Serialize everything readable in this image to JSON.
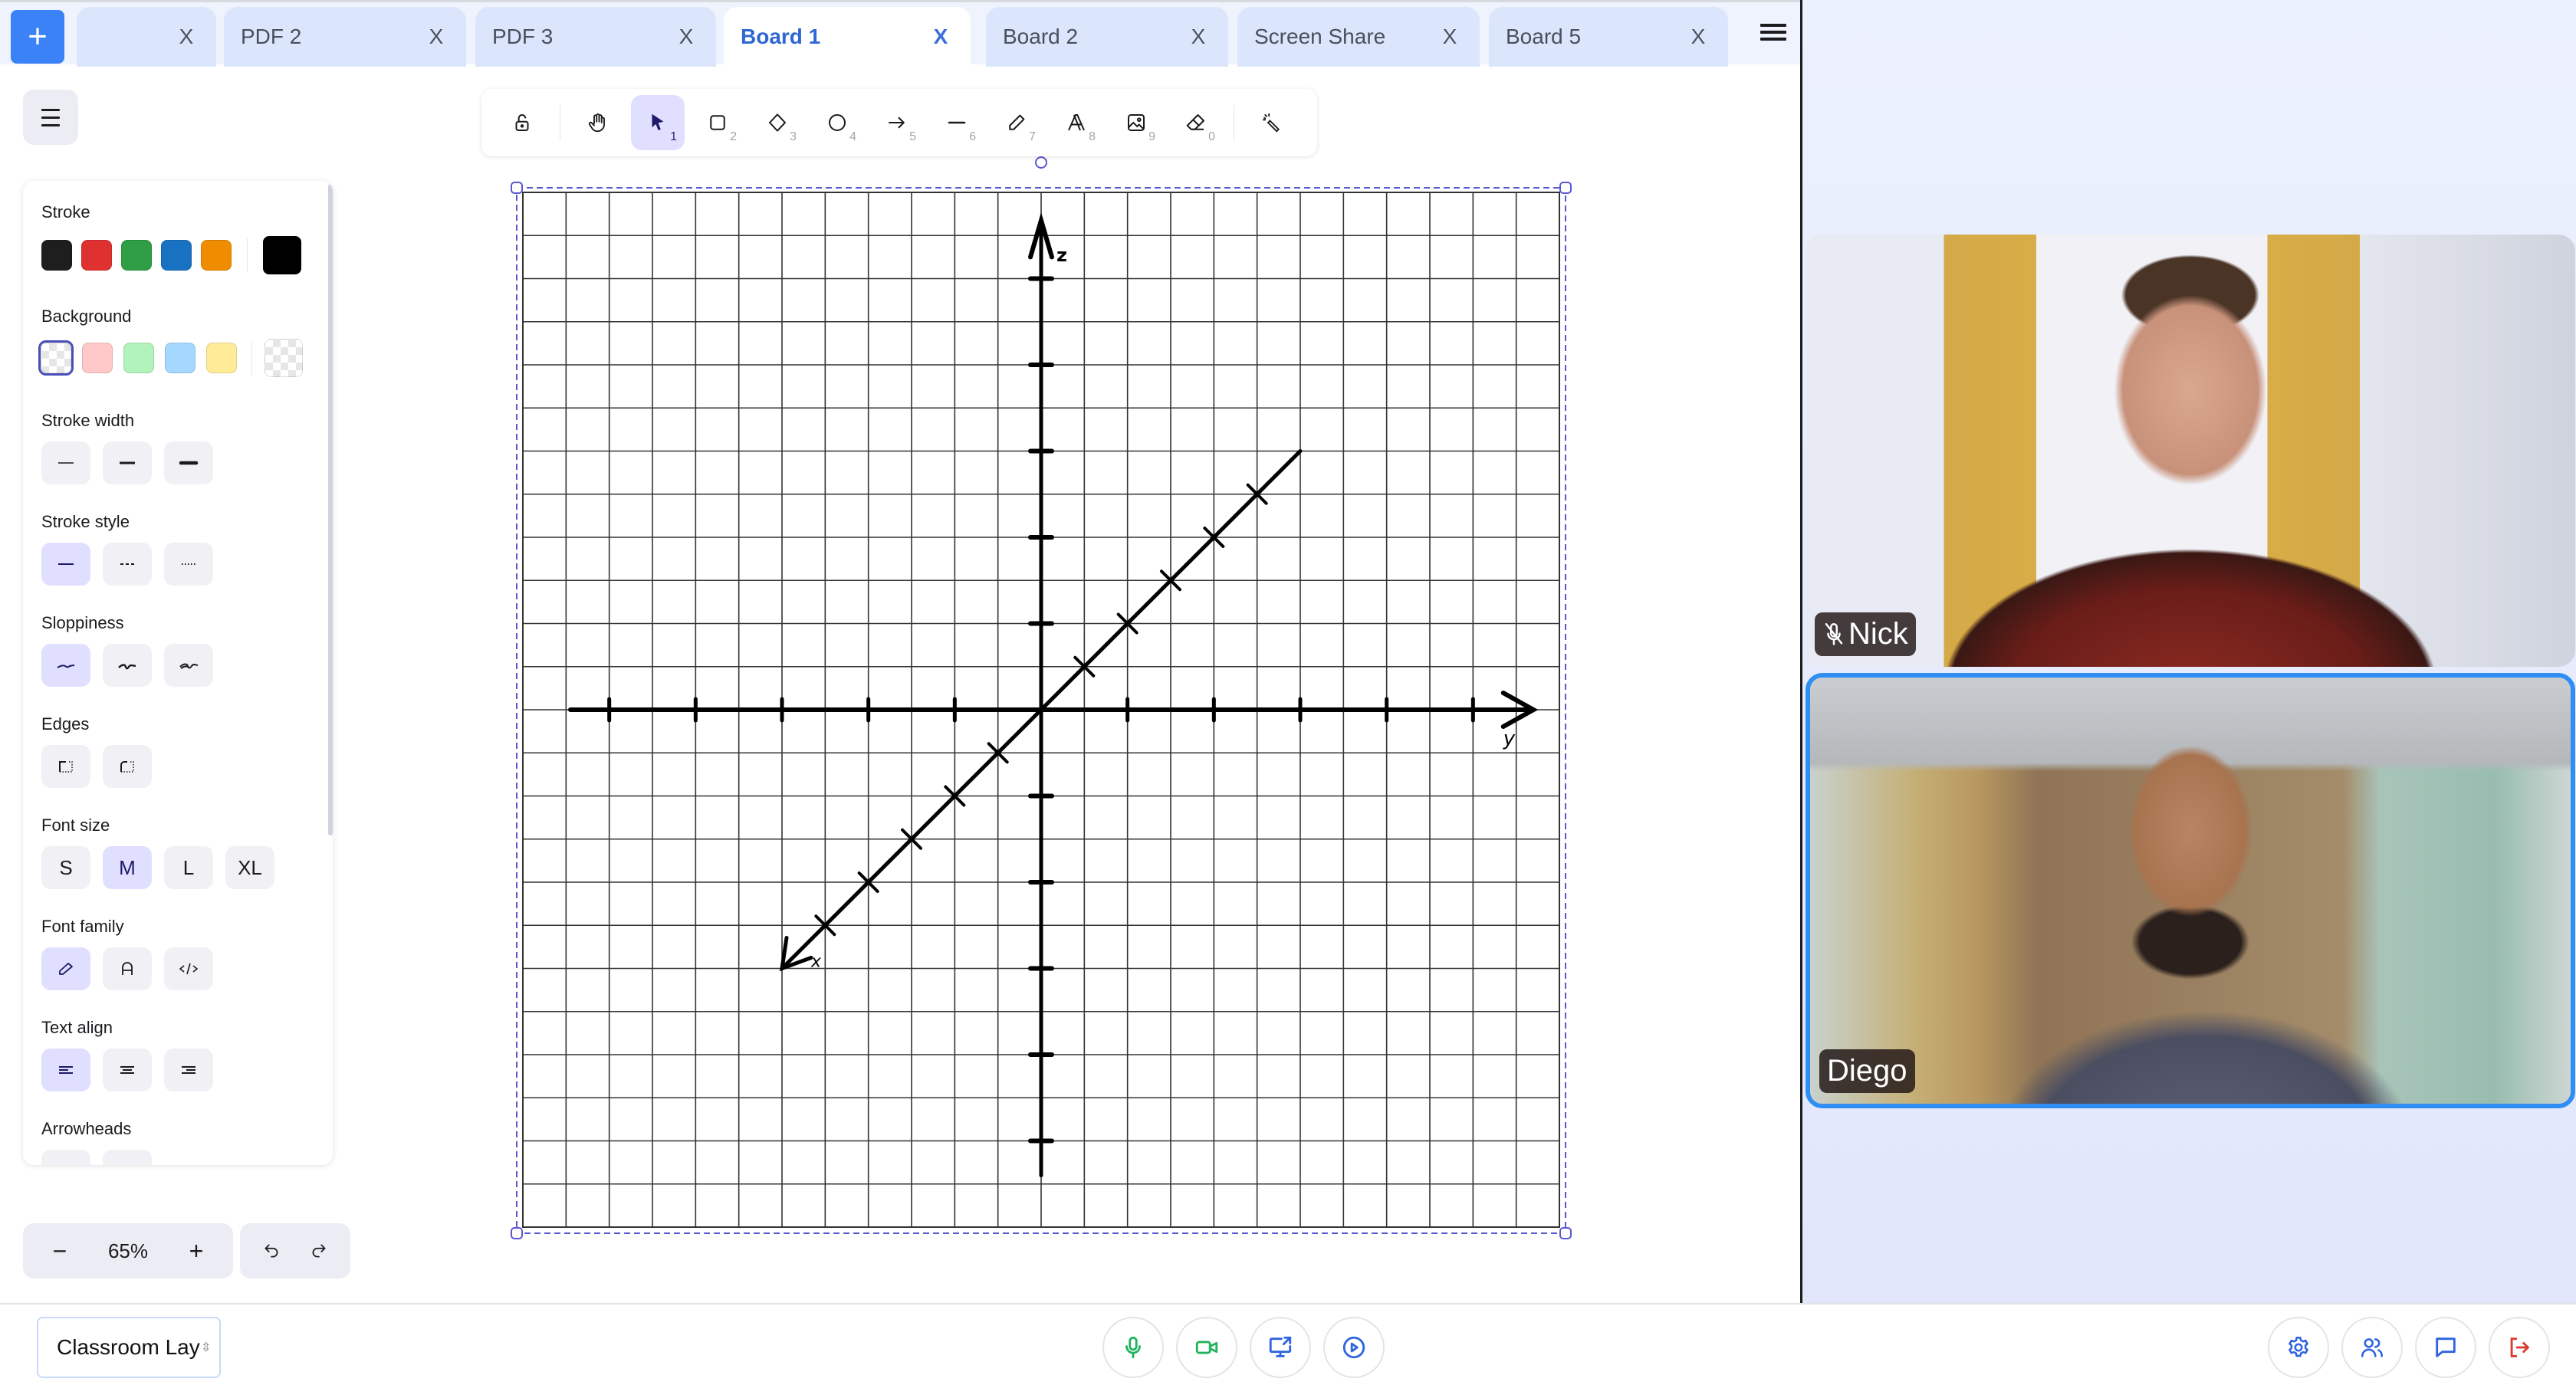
{
  "tabbar": {
    "add_label": "+",
    "tabs": [
      {
        "label": "",
        "close": "X",
        "active": false
      },
      {
        "label": "PDF 2",
        "close": "X",
        "active": false
      },
      {
        "label": "PDF 3",
        "close": "X",
        "active": false
      },
      {
        "label": "Board 1",
        "close": "X",
        "active": true
      },
      {
        "label": "Board 2",
        "close": "X",
        "active": false
      },
      {
        "label": "Screen Share",
        "close": "X",
        "active": false
      },
      {
        "label": "Board 5",
        "close": "X",
        "active": false
      }
    ]
  },
  "toolbar": {
    "tools": [
      {
        "name": "lock",
        "key": ""
      },
      {
        "name": "hand",
        "key": ""
      },
      {
        "name": "selection",
        "key": "1",
        "active": true
      },
      {
        "name": "rectangle",
        "key": "2"
      },
      {
        "name": "diamond",
        "key": "3"
      },
      {
        "name": "ellipse",
        "key": "4"
      },
      {
        "name": "arrow",
        "key": "5"
      },
      {
        "name": "line",
        "key": "6"
      },
      {
        "name": "draw",
        "key": "7"
      },
      {
        "name": "text",
        "key": "8"
      },
      {
        "name": "image",
        "key": "9"
      },
      {
        "name": "eraser",
        "key": "0"
      },
      {
        "name": "laser",
        "key": ""
      }
    ]
  },
  "properties": {
    "stroke_label": "Stroke",
    "stroke_colors": [
      "#1e1e1e",
      "#e03131",
      "#2f9e44",
      "#1971c2",
      "#f08c00"
    ],
    "stroke_current": "#000000",
    "background_label": "Background",
    "background_colors": [
      "transparent",
      "#ffc9c9",
      "#b2f2bb",
      "#a5d8ff",
      "#ffec99"
    ],
    "background_current": "transparent",
    "stroke_width_label": "Stroke width",
    "stroke_style_label": "Stroke style",
    "sloppiness_label": "Sloppiness",
    "edges_label": "Edges",
    "font_size_label": "Font size",
    "font_sizes": [
      "S",
      "M",
      "L",
      "XL"
    ],
    "font_size_selected": "M",
    "font_family_label": "Font family",
    "text_align_label": "Text align",
    "arrowheads_label": "Arrowheads"
  },
  "zoom": {
    "minus": "−",
    "value": "65%",
    "plus": "+"
  },
  "canvas": {
    "axis_labels": {
      "horizontal": "y",
      "vertical": "z",
      "diagonal": "x"
    },
    "grid_cells": 24,
    "tick_every": 2,
    "axis_extent": 11,
    "diagonal_extent": 6,
    "diagonal_marks": 5
  },
  "participants": [
    {
      "name": "Nick",
      "muted": true,
      "speaking": false
    },
    {
      "name": "Diego",
      "muted": false,
      "speaking": true
    }
  ],
  "bottombar": {
    "layout_value": "Classroom Layout",
    "controls": [
      "microphone",
      "camera",
      "screen-share",
      "record"
    ],
    "right_controls": [
      "settings",
      "participants",
      "chat",
      "leave"
    ],
    "colors": {
      "green": "#22b35e",
      "blue": "#2f63e0",
      "red": "#d93a2b"
    }
  }
}
